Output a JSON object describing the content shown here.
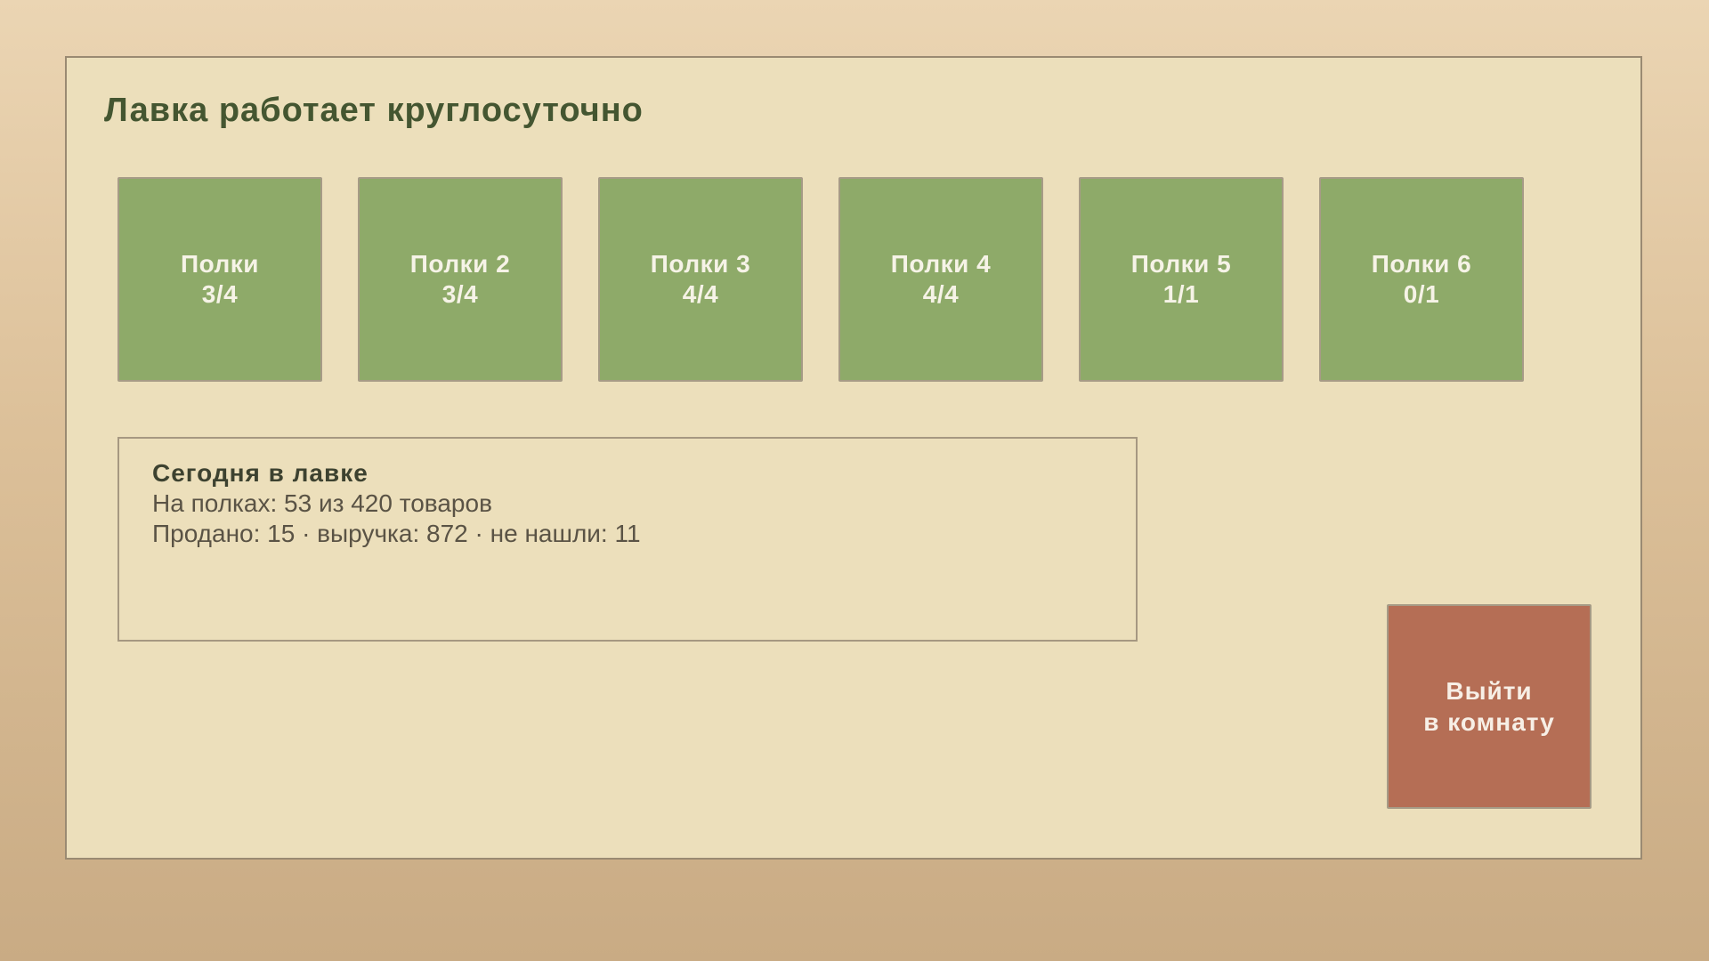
{
  "title": "Лавка работает круглосуточно",
  "shelves": [
    {
      "label": "Полки",
      "count": "3/4"
    },
    {
      "label": "Полки 2",
      "count": "3/4"
    },
    {
      "label": "Полки 3",
      "count": "4/4"
    },
    {
      "label": "Полки 4",
      "count": "4/4"
    },
    {
      "label": "Полки 5",
      "count": "1/1"
    },
    {
      "label": "Полки 6",
      "count": "0/1"
    }
  ],
  "stats": {
    "title": "Сегодня в лавке",
    "line1": "На полках: 53 из 420 товаров",
    "line2": "Продано: 15 · выручка: 872 · не нашли: 11"
  },
  "exit_button": {
    "line1": "Выйти",
    "line2": "в комнату"
  },
  "colors": {
    "shelf": "#8eaa69",
    "exit": "#b56e55",
    "panel": "#ecdfbb",
    "title": "#445631"
  }
}
